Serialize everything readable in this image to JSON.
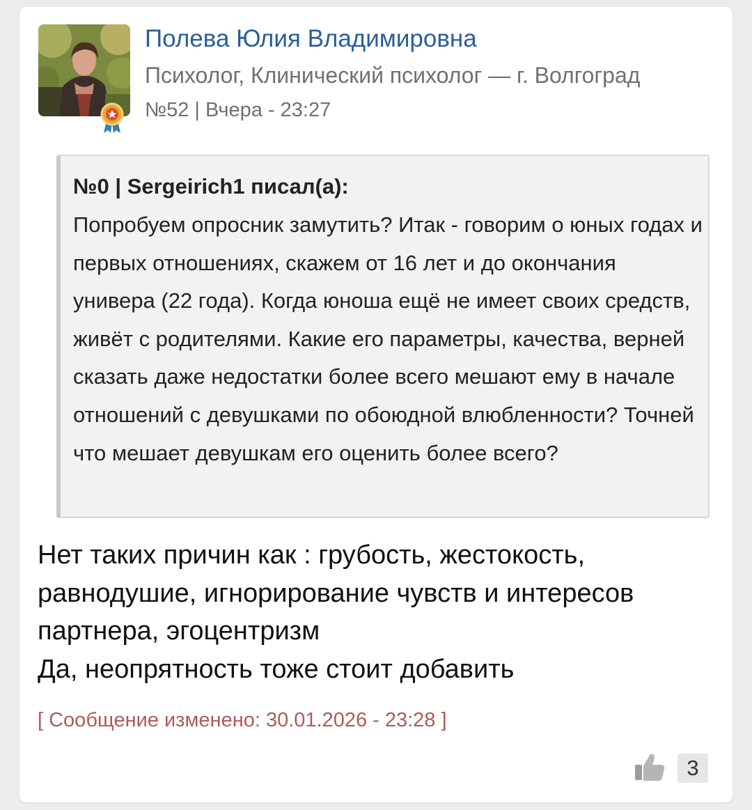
{
  "post": {
    "author_name": "Полева Юлия Владимировна",
    "author_role": "Психолог, Клинический психолог — г. Волгоград",
    "meta": "№52 | Вчера - 23:27",
    "avatar_icon": "user-photo-avatar",
    "badge_icon": "award-medal-icon",
    "quote": {
      "header": "№0 | Sergeirich1 писал(а):",
      "body": "Попробуем опросник замутить? Итак - говорим о юных годах и первых отношениях, скажем от 16 лет и до окончания универа (22 года). Когда юноша ещё не имеет своих средств, живёт с родителями. Какие его параметры, качества, верней сказать даже недостатки более всего мешают ему в начале отношений с девушками по обоюдной влюбленности? Точней что мешает девушкам его оценить более всего?"
    },
    "message": {
      "line1": "Нет таких причин как : грубость, жестокость, равнодушие, игнорирование чувств и интересов партнера, эгоцентризм",
      "line2": "Да, неопрятность тоже стоит добавить"
    },
    "edited_note": "[ Сообщение изменено: 30.01.2026 - 23:28 ]",
    "likes": {
      "icon": "thumbs-up-icon",
      "count": "3"
    }
  },
  "colors": {
    "author_name": "#2a5e99",
    "muted": "#707070",
    "edited": "#b05a5a",
    "quote_bg": "#f2f2f2",
    "page_bg": "#ececec"
  }
}
